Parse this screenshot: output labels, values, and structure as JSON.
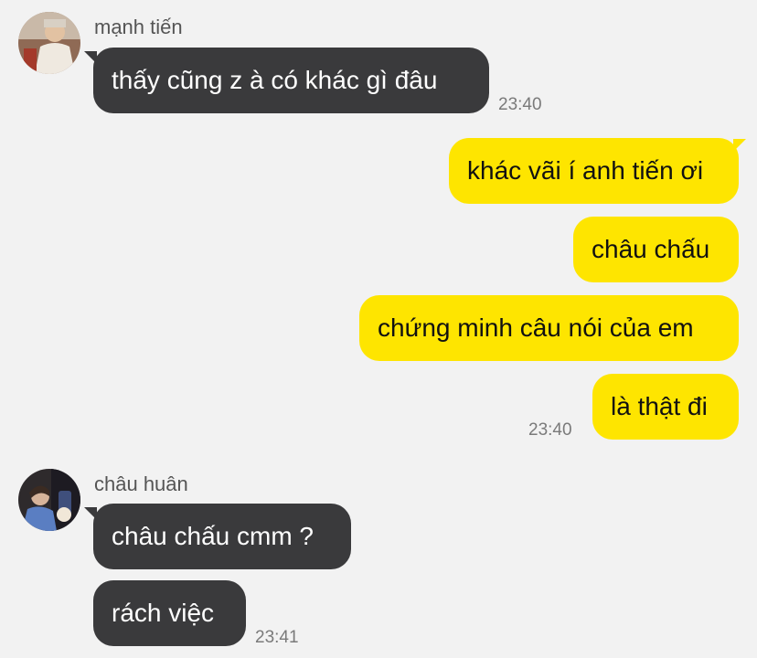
{
  "messages": [
    {
      "sender": "mạnh tiến",
      "text": "thấy cũng z à có khác gì đâu",
      "time": "23:40"
    },
    {
      "text": "khác vãi í anh tiến ơi"
    },
    {
      "text": "châu chấu"
    },
    {
      "text": "chứng minh câu nói của em"
    },
    {
      "text": "là thật đi",
      "time": "23:40"
    },
    {
      "sender": "châu huân",
      "text": "châu chấu cmm ?"
    },
    {
      "text": "rách việc",
      "time": "23:41"
    }
  ],
  "colors": {
    "background": "#f2f2f2",
    "incoming_bubble": "#3a3a3c",
    "outgoing_bubble": "#fee500"
  }
}
